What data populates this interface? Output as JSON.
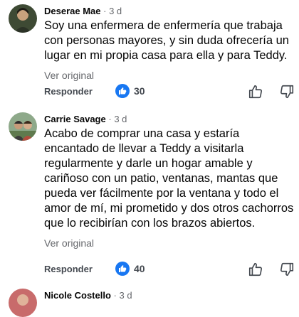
{
  "comments": [
    {
      "author": "Deserae Mae",
      "dot": "·",
      "time": "3 d",
      "text": "Soy una enfermera de enfermería que trabaja con personas mayores, y sin duda ofrecería un lugar en mi propia casa para ella y para Teddy.",
      "translate_label": "Ver original",
      "reply_label": "Responder",
      "reaction_count": "30"
    },
    {
      "author": "Carrie Savage",
      "dot": "·",
      "time": "3 d",
      "text": "Acabo de comprar una casa y estaría encantado de llevar a Teddy a visitarla regularmente y darle un hogar amable y cariñoso con un patio, ventanas, mantas que pueda ver fácilmente por la ventana y todo el amor de mí, mi prometido y dos otros cachorros que lo recibirían con los brazos abiertos.",
      "translate_label": "Ver original",
      "reply_label": "Responder",
      "reaction_count": "40"
    },
    {
      "author": "Nicole Costello",
      "dot": "·",
      "time": "3 d"
    }
  ],
  "icons": {
    "reaction": "like-reaction-icon",
    "upvote": "thumbs-up-outline-icon",
    "downvote": "thumbs-down-outline-icon"
  },
  "colors": {
    "accent": "#1877f2",
    "secondary_text": "#65676b",
    "primary_text": "#050505"
  }
}
